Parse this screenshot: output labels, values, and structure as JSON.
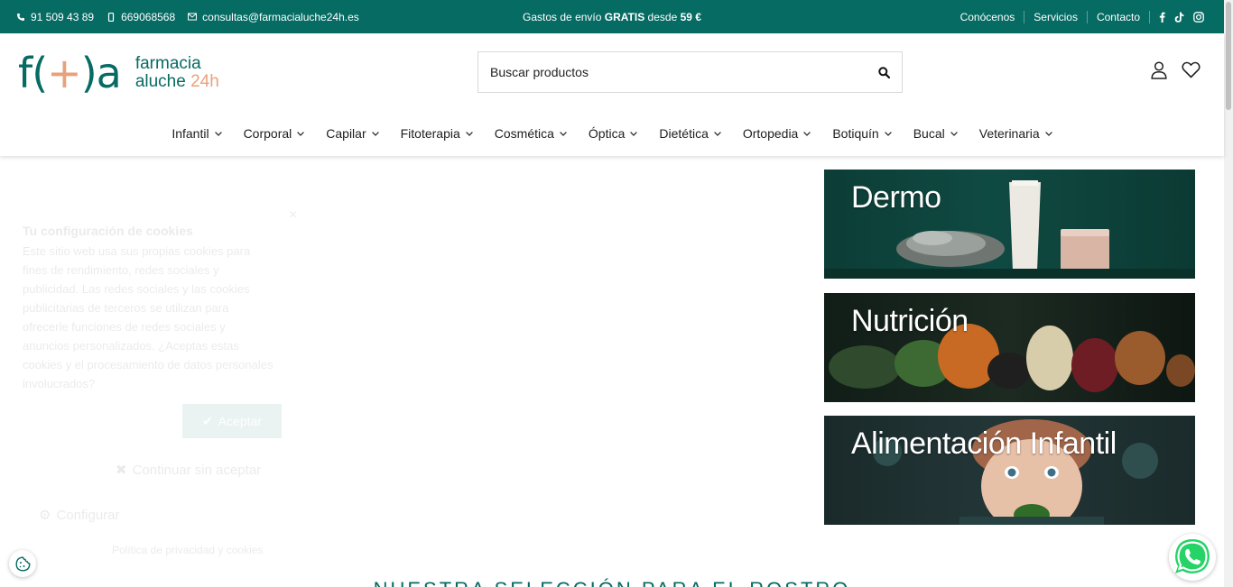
{
  "topbar": {
    "phone": "91 509 43 89",
    "mobile": "669068568",
    "email": "consultas@farmacialuche24h.es",
    "promo_prefix": "Gastos de envío ",
    "promo_bold": "GRATIS",
    "promo_mid": " desde ",
    "promo_amount": "59 €",
    "links": [
      "Conócenos",
      "Servicios",
      "Contacto"
    ]
  },
  "logo": {
    "mark_left": "f(",
    "mark_plus": "+",
    "mark_right": ")a",
    "line1": "farmacia",
    "line2": "aluche",
    "line2_accent": " 24h"
  },
  "search": {
    "placeholder": "Buscar productos"
  },
  "nav": [
    "Infantil",
    "Corporal",
    "Capilar",
    "Fitoterapia",
    "Cosmética",
    "Óptica",
    "Dietética",
    "Ortopedia",
    "Botiquín",
    "Bucal",
    "Veterinaria"
  ],
  "banners": [
    "Dermo",
    "Nutrición",
    "Alimentación Infantil"
  ],
  "cookie": {
    "title": "Tu configuración de cookies",
    "text": "Este sitio web usa sus propias cookies para fines de rendimiento, redes sociales y publicidad. Las redes sociales y las cookies publicitarias de terceros se utilizan para ofrecerle funciones de redes sociales y anuncios personalizados. ¿Aceptas estas cookies y el procesamiento de datos personales involucrados?",
    "accept": "Aceptar",
    "continue": "Continuar sin aceptar",
    "configure": "Configurar",
    "policy": "Política de privacidad y cookies"
  },
  "section_title": "NUESTRA SELECCIÓN PARA EL ROSTRO",
  "colors": {
    "brand": "#066b63",
    "accent": "#e8a27b",
    "whatsapp": "#25d366"
  }
}
